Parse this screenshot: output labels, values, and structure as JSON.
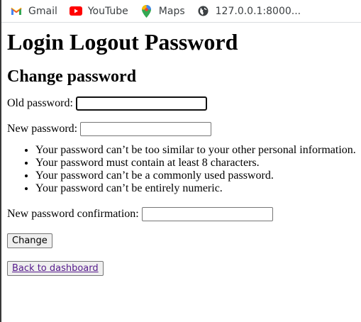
{
  "bookmarks": [
    {
      "label": "Gmail",
      "icon": "gmail-icon"
    },
    {
      "label": "YouTube",
      "icon": "youtube-icon"
    },
    {
      "label": "Maps",
      "icon": "maps-icon"
    },
    {
      "label": "127.0.0.1:8000...",
      "icon": "globe-icon"
    }
  ],
  "page": {
    "title": "Login Logout Password",
    "subtitle": "Change password"
  },
  "form": {
    "old_password_label": "Old password:",
    "old_password_value": "",
    "new_password_label": "New password:",
    "new_password_value": "",
    "help": [
      "Your password can’t be too similar to your other personal information.",
      "Your password must contain at least 8 characters.",
      "Your password can’t be a commonly used password.",
      "Your password can’t be entirely numeric."
    ],
    "confirm_label": "New password confirmation:",
    "confirm_value": "",
    "submit_label": "Change"
  },
  "back_link": "Back to dashboard",
  "colors": {
    "link_visited": "#551a8b",
    "button_bg": "#efefef"
  }
}
